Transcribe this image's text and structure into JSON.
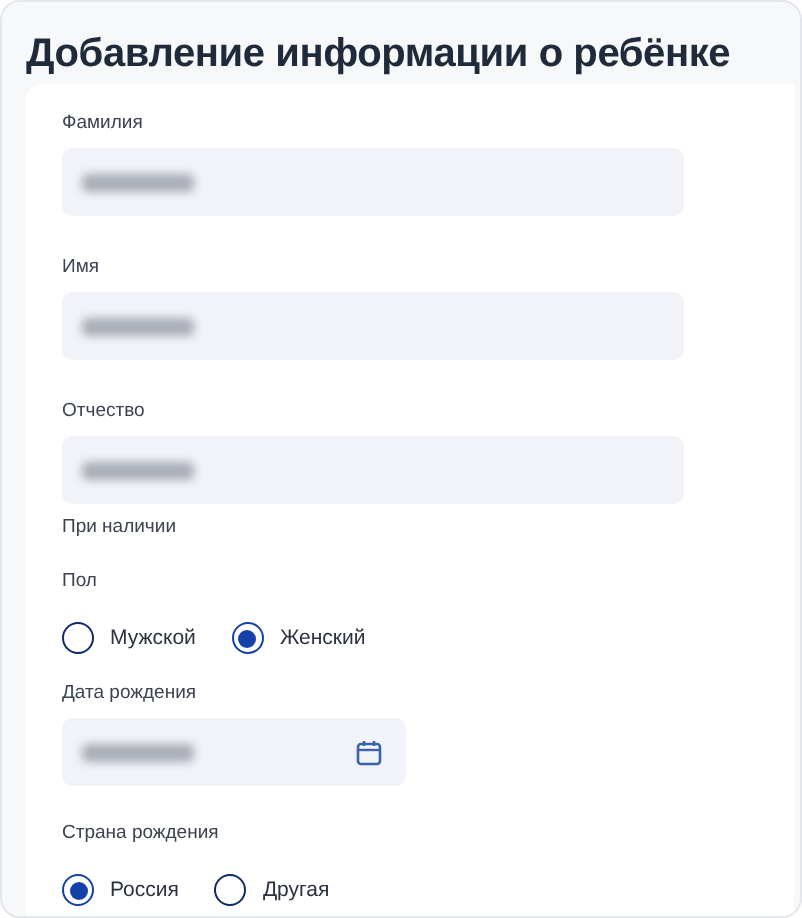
{
  "title": "Добавление информации о ребёнке",
  "fields": [
    {
      "kind": "text",
      "label": "Фамилия",
      "value_hidden": true
    },
    {
      "kind": "text",
      "label": "Имя",
      "value_hidden": true
    },
    {
      "kind": "text",
      "label": "Отчество",
      "value_hidden": true,
      "hint": "При наличии"
    },
    {
      "kind": "radio",
      "label": "Пол",
      "options": [
        {
          "label": "Мужской",
          "selected": false
        },
        {
          "label": "Женский",
          "selected": true
        }
      ]
    },
    {
      "kind": "date",
      "label": "Дата рождения",
      "value_hidden": true
    },
    {
      "kind": "radio",
      "label": "Страна рождения",
      "options": [
        {
          "label": "Россия",
          "selected": true
        },
        {
          "label": "Другая",
          "selected": false
        }
      ]
    }
  ]
}
